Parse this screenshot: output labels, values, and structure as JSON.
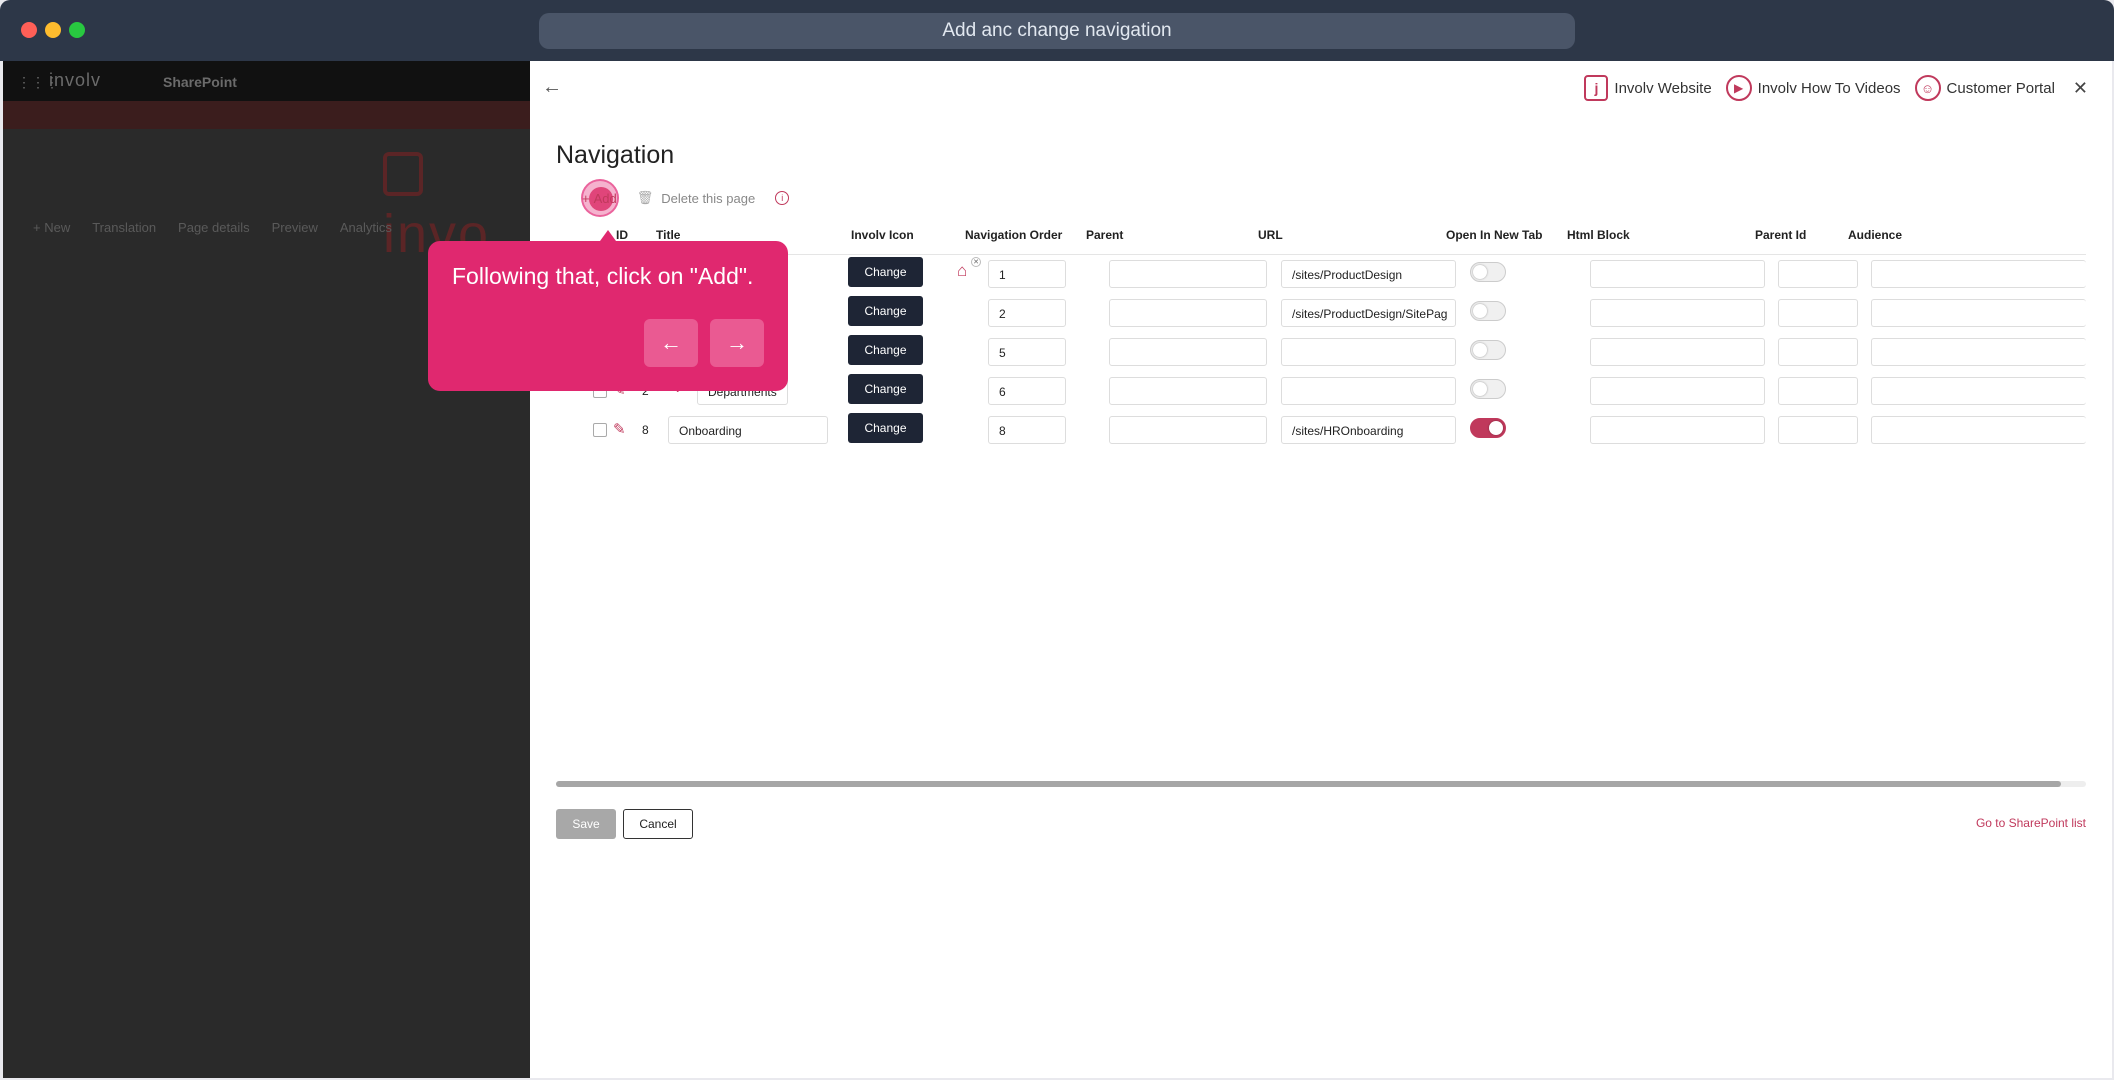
{
  "window": {
    "title": "Add anc change navigation"
  },
  "background": {
    "logo_text": "involv",
    "app_name": "SharePoint",
    "big_logo_text": "invo",
    "commands": [
      "+ New",
      "Translation",
      "Page details",
      "Preview",
      "Analytics"
    ]
  },
  "header": {
    "links": [
      {
        "label": "Involv Website",
        "icon": "involv-logo-icon"
      },
      {
        "label": "Involv How To Videos",
        "icon": "play-icon"
      },
      {
        "label": "Customer Portal",
        "icon": "user-portal-icon"
      }
    ],
    "close_label": "✕",
    "back_label": "←"
  },
  "page": {
    "title": "Navigation"
  },
  "toolbar": {
    "add_label": "Add",
    "delete_label": "Delete this page"
  },
  "table": {
    "columns": {
      "id": "ID",
      "title": "Title",
      "icon": "Involv Icon",
      "order": "Navigation Order",
      "parent": "Parent",
      "url": "URL",
      "newtab": "Open In New Tab",
      "html": "Html Block",
      "parentid": "Parent Id",
      "audience": "Audience"
    },
    "change_label": "Change",
    "rows": [
      {
        "id": "",
        "title": "",
        "order": "1",
        "parent": "",
        "url": "/sites/ProductDesign",
        "newtab": false
      },
      {
        "id": "",
        "title": "",
        "order": "2",
        "parent": "",
        "url": "/sites/ProductDesign/SitePag",
        "newtab": false
      },
      {
        "id": "",
        "title": "",
        "order": "5",
        "parent": "",
        "url": "",
        "newtab": false
      },
      {
        "id": "2",
        "title": "Departments",
        "order": "6",
        "parent": "",
        "url": "",
        "newtab": false
      },
      {
        "id": "8",
        "title": "Onboarding",
        "order": "8",
        "parent": "",
        "url": "/sites/HROnboarding",
        "newtab": true
      }
    ]
  },
  "footer": {
    "save_label": "Save",
    "cancel_label": "Cancel",
    "sharepoint_link": "Go to SharePoint list"
  },
  "tooltip": {
    "text": "Following that, click on \"Add\".",
    "prev_label": "←",
    "next_label": "→"
  },
  "colors": {
    "accent": "#c0395c",
    "tooltip": "#e0286f",
    "dark_button": "#1e2535"
  }
}
